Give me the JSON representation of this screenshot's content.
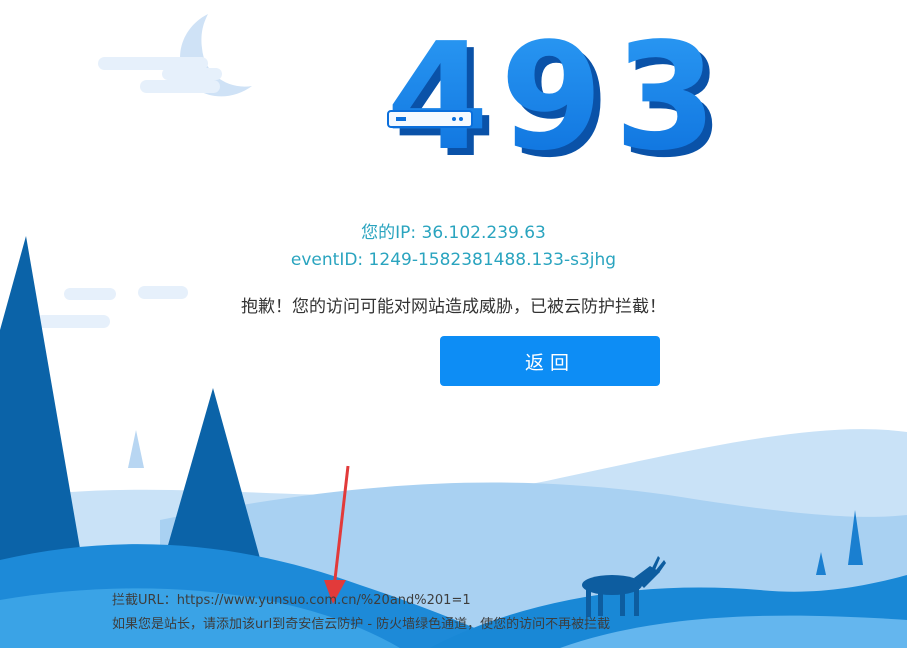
{
  "error": {
    "code_digits": [
      "4",
      "9",
      "3"
    ]
  },
  "info": {
    "ip_line": "您的IP: 36.102.239.63",
    "event_line": "eventID: 1249-1582381488.133-s3jhg",
    "message": "抱歉！您的访问可能对网站造成威胁，已被云防护拦截！"
  },
  "actions": {
    "back_label": "返回"
  },
  "footer": {
    "intercept_url_line": "拦截URL：https://www.yunsuo.com.cn/%20and%201=1",
    "admin_hint": "如果您是站长，请添加该url到奇安信云防护 - 防火墙绿色通道，使您的访问不再被拦截"
  },
  "colors": {
    "primary_blue": "#0d8df5",
    "info_cyan": "#2aa4bf",
    "annotation_red": "#e23a3a"
  }
}
